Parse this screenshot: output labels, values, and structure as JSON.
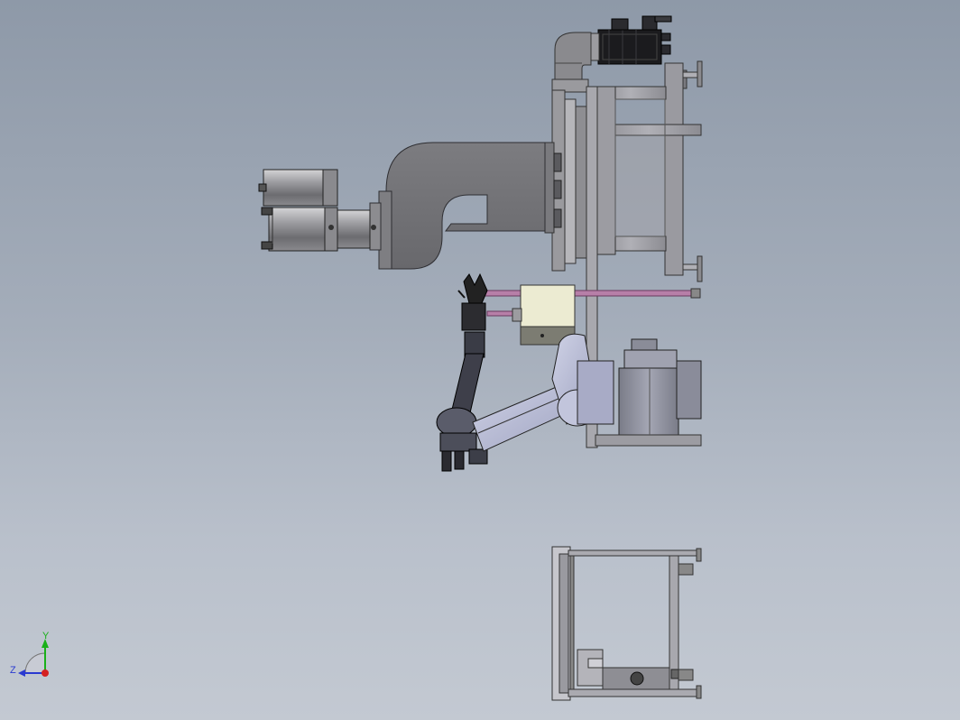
{
  "viewport": {
    "background_top": "#8e99a8",
    "background_bottom": "#c3c9d2"
  },
  "model": {
    "components": [
      "servo-motor",
      "elbow-duct",
      "mounting-frame",
      "flange-plate",
      "twin-cylinder",
      "rail-guide",
      "gripper",
      "robot-arm",
      "base-motor",
      "side-view-frame"
    ],
    "colors": {
      "metal_dark": "#6e6f74",
      "metal_mid": "#8a8b90",
      "frame": "#9c9ca2",
      "arm": "#b4b8d2",
      "rail": "#b77fa8",
      "box": "#ecebd2",
      "motor": "#1b1b1e"
    }
  },
  "triad": {
    "x_label": "X",
    "y_label": "Y",
    "z_label": "Z",
    "x_color": "#d42020",
    "y_color": "#19b019",
    "z_color": "#2a3ad0"
  }
}
